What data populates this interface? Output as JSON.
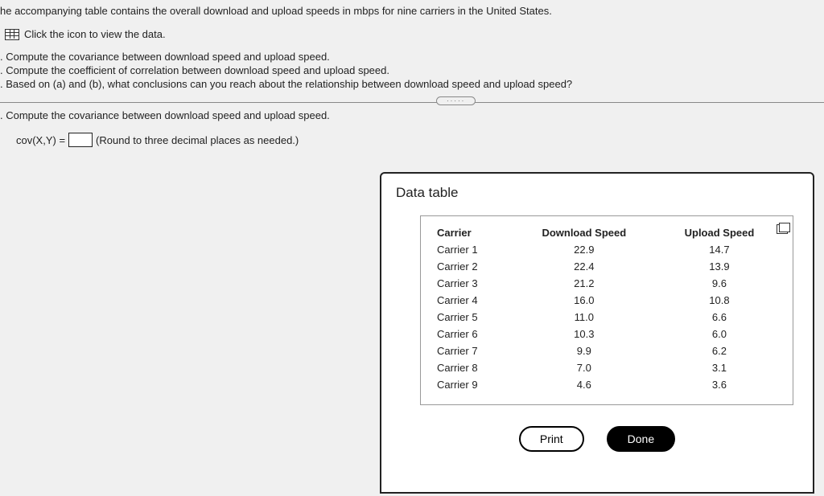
{
  "intro": "he accompanying table contains the overall download and upload speeds in mbps for nine carriers in the United States.",
  "icon_text": "Click the icon to view the data.",
  "tasks": {
    "a": ". Compute the covariance between download speed and upload speed.",
    "b": ". Compute the coefficient of correlation between download speed and upload speed.",
    "c": ". Based on (a) and (b), what conclusions can you reach about the relationship between download speed and upload speed?"
  },
  "section_header": ". Compute the covariance between download speed and upload speed.",
  "answer": {
    "prefix": "cov(X,Y) =",
    "suffix": "(Round to three decimal places as needed.)"
  },
  "popup": {
    "title": "Data table",
    "headers": {
      "c1": "Carrier",
      "c2": "Download Speed",
      "c3": "Upload Speed"
    },
    "rows": [
      {
        "carrier": "Carrier 1",
        "download": "22.9",
        "upload": "14.7"
      },
      {
        "carrier": "Carrier 2",
        "download": "22.4",
        "upload": "13.9"
      },
      {
        "carrier": "Carrier 3",
        "download": "21.2",
        "upload": "9.6"
      },
      {
        "carrier": "Carrier 4",
        "download": "16.0",
        "upload": "10.8"
      },
      {
        "carrier": "Carrier 5",
        "download": "11.0",
        "upload": "6.6"
      },
      {
        "carrier": "Carrier 6",
        "download": "10.3",
        "upload": "6.0"
      },
      {
        "carrier": "Carrier 7",
        "download": "9.9",
        "upload": "6.2"
      },
      {
        "carrier": "Carrier 8",
        "download": "7.0",
        "upload": "3.1"
      },
      {
        "carrier": "Carrier 9",
        "download": "4.6",
        "upload": "3.6"
      }
    ],
    "print_label": "Print",
    "done_label": "Done"
  },
  "chart_data": {
    "type": "table",
    "title": "Data table",
    "columns": [
      "Carrier",
      "Download Speed",
      "Upload Speed"
    ],
    "rows": [
      [
        "Carrier 1",
        22.9,
        14.7
      ],
      [
        "Carrier 2",
        22.4,
        13.9
      ],
      [
        "Carrier 3",
        21.2,
        9.6
      ],
      [
        "Carrier 4",
        16.0,
        10.8
      ],
      [
        "Carrier 5",
        11.0,
        6.6
      ],
      [
        "Carrier 6",
        10.3,
        6.0
      ],
      [
        "Carrier 7",
        9.9,
        6.2
      ],
      [
        "Carrier 8",
        7.0,
        3.1
      ],
      [
        "Carrier 9",
        4.6,
        3.6
      ]
    ]
  }
}
